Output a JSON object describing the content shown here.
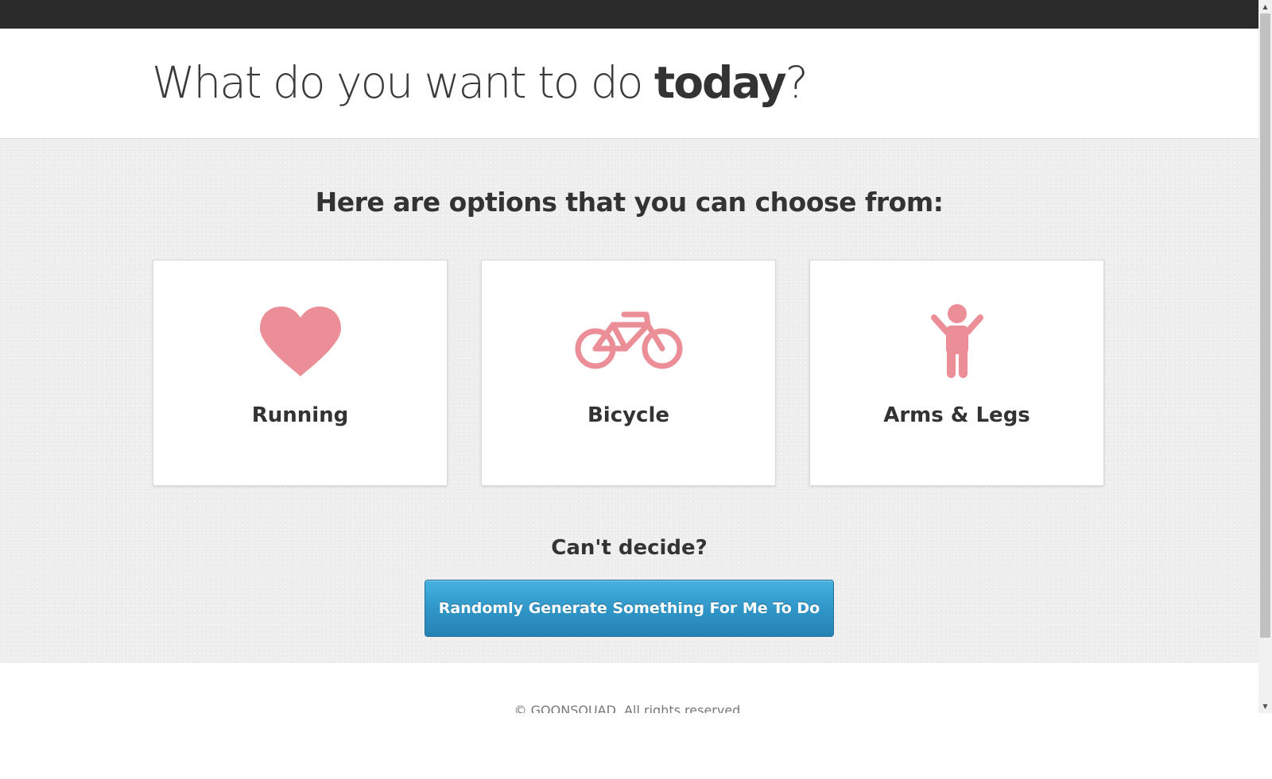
{
  "header": {
    "title_prefix": "What do you want to do ",
    "title_bold": "today",
    "title_suffix": "?"
  },
  "main": {
    "options_heading": "Here are options that you can choose from:",
    "options": [
      {
        "label": "Running",
        "icon": "heart-icon"
      },
      {
        "label": "Bicycle",
        "icon": "bicycle-icon"
      },
      {
        "label": "Arms & Legs",
        "icon": "person-icon"
      }
    ],
    "cant_decide": "Can't decide?",
    "random_button_label": "Randomly Generate Something For Me To Do"
  },
  "footer": {
    "copyright": "© GOONSQUAD. All rights reserved."
  },
  "colors": {
    "icon": "#ec8e97",
    "button": "#2f94c6",
    "topbar": "#2b2b2b",
    "text": "#333333"
  }
}
